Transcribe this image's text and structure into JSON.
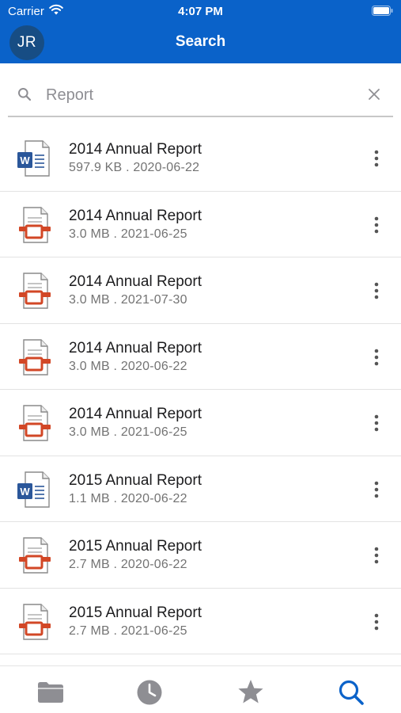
{
  "status_bar": {
    "carrier": "Carrier",
    "time": "4:07 PM"
  },
  "nav": {
    "avatar_initials": "JR",
    "title": "Search"
  },
  "search": {
    "value": "",
    "placeholder": "Report"
  },
  "files": [
    {
      "name": "2014 Annual Report",
      "meta": "597.9 KB . 2020-06-22",
      "icon": "word-document-icon"
    },
    {
      "name": "2014 Annual Report",
      "meta": "3.0 MB . 2021-06-25",
      "icon": "presentation-document-icon"
    },
    {
      "name": "2014 Annual Report",
      "meta": "3.0 MB . 2021-07-30",
      "icon": "presentation-document-icon"
    },
    {
      "name": "2014 Annual Report",
      "meta": "3.0 MB . 2020-06-22",
      "icon": "presentation-document-icon"
    },
    {
      "name": "2014 Annual Report",
      "meta": "3.0 MB . 2021-06-25",
      "icon": "presentation-document-icon"
    },
    {
      "name": "2015 Annual Report",
      "meta": "1.1 MB . 2020-06-22",
      "icon": "word-document-icon"
    },
    {
      "name": "2015 Annual Report",
      "meta": "2.7 MB . 2020-06-22",
      "icon": "presentation-document-icon"
    },
    {
      "name": "2015 Annual Report",
      "meta": "2.7 MB . 2021-06-25",
      "icon": "presentation-document-icon"
    }
  ],
  "tabs": [
    {
      "id": "files",
      "icon": "folder-icon",
      "active": false
    },
    {
      "id": "recent",
      "icon": "clock-icon",
      "active": false
    },
    {
      "id": "favorites",
      "icon": "star-icon",
      "active": false
    },
    {
      "id": "search",
      "icon": "search-icon",
      "active": true
    }
  ],
  "colors": {
    "header_bg": "#0a62c9",
    "avatar_bg": "#174d84",
    "word_blue": "#2b579a",
    "presentation_orange": "#d24726",
    "active_tab": "#0a62c9",
    "inactive_tab": "#8e8e93"
  }
}
